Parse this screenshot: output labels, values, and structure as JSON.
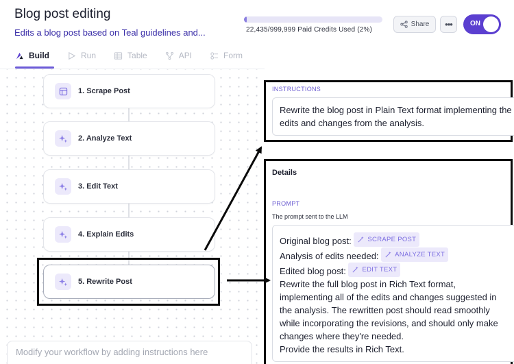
{
  "header": {
    "title": "Blog post editing",
    "subtitle": "Edits a blog post based on Teal guidelines and...",
    "credits_text": "22,435/999,999 Paid Credits Used (2%)",
    "credits_progress": 0.02,
    "share_label": "Share",
    "more_label": "•••",
    "toggle_label": "ON",
    "accent_color": "#5b3fd0"
  },
  "tabs": [
    {
      "label": "Build",
      "icon": "build-icon",
      "active": true
    },
    {
      "label": "Run",
      "icon": "play-icon",
      "active": false
    },
    {
      "label": "Table",
      "icon": "table-icon",
      "active": false
    },
    {
      "label": "API",
      "icon": "api-icon",
      "active": false
    },
    {
      "label": "Form",
      "icon": "form-icon",
      "active": false
    }
  ],
  "workflow": {
    "nodes": [
      {
        "label": "1. Scrape Post",
        "icon": "layout-icon"
      },
      {
        "label": "2. Analyze Text",
        "icon": "sparkle-icon"
      },
      {
        "label": "3. Edit Text",
        "icon": "sparkle-icon"
      },
      {
        "label": "4. Explain Edits",
        "icon": "sparkle-icon"
      },
      {
        "label": "5. Rewrite Post",
        "icon": "sparkle-icon",
        "selected": true
      }
    ],
    "instruction_placeholder": "Modify your workflow by adding instructions here"
  },
  "instructions_panel": {
    "label": "INSTRUCTIONS",
    "text": "Rewrite the blog post in Plain Text format implementing the edits and changes from the analysis."
  },
  "details_panel": {
    "heading": "Details",
    "prompt_label": "PROMPT",
    "prompt_hint": "The prompt sent to the LLM",
    "lines": [
      {
        "text": "Original blog post:",
        "chip": "SCRAPE POST"
      },
      {
        "text": "Analysis of edits needed:",
        "chip": "ANALYZE TEXT"
      },
      {
        "text": "Edited blog post:",
        "chip": "EDIT TEXT"
      }
    ],
    "body": "Rewrite the full blog post in Rich Text format, implementing all of the edits and changes suggested in the analysis. The rewritten post should read smoothly while incorporating the revisions, and should only make changes where they're needed.",
    "closing": "Provide the results in Rich Text."
  }
}
